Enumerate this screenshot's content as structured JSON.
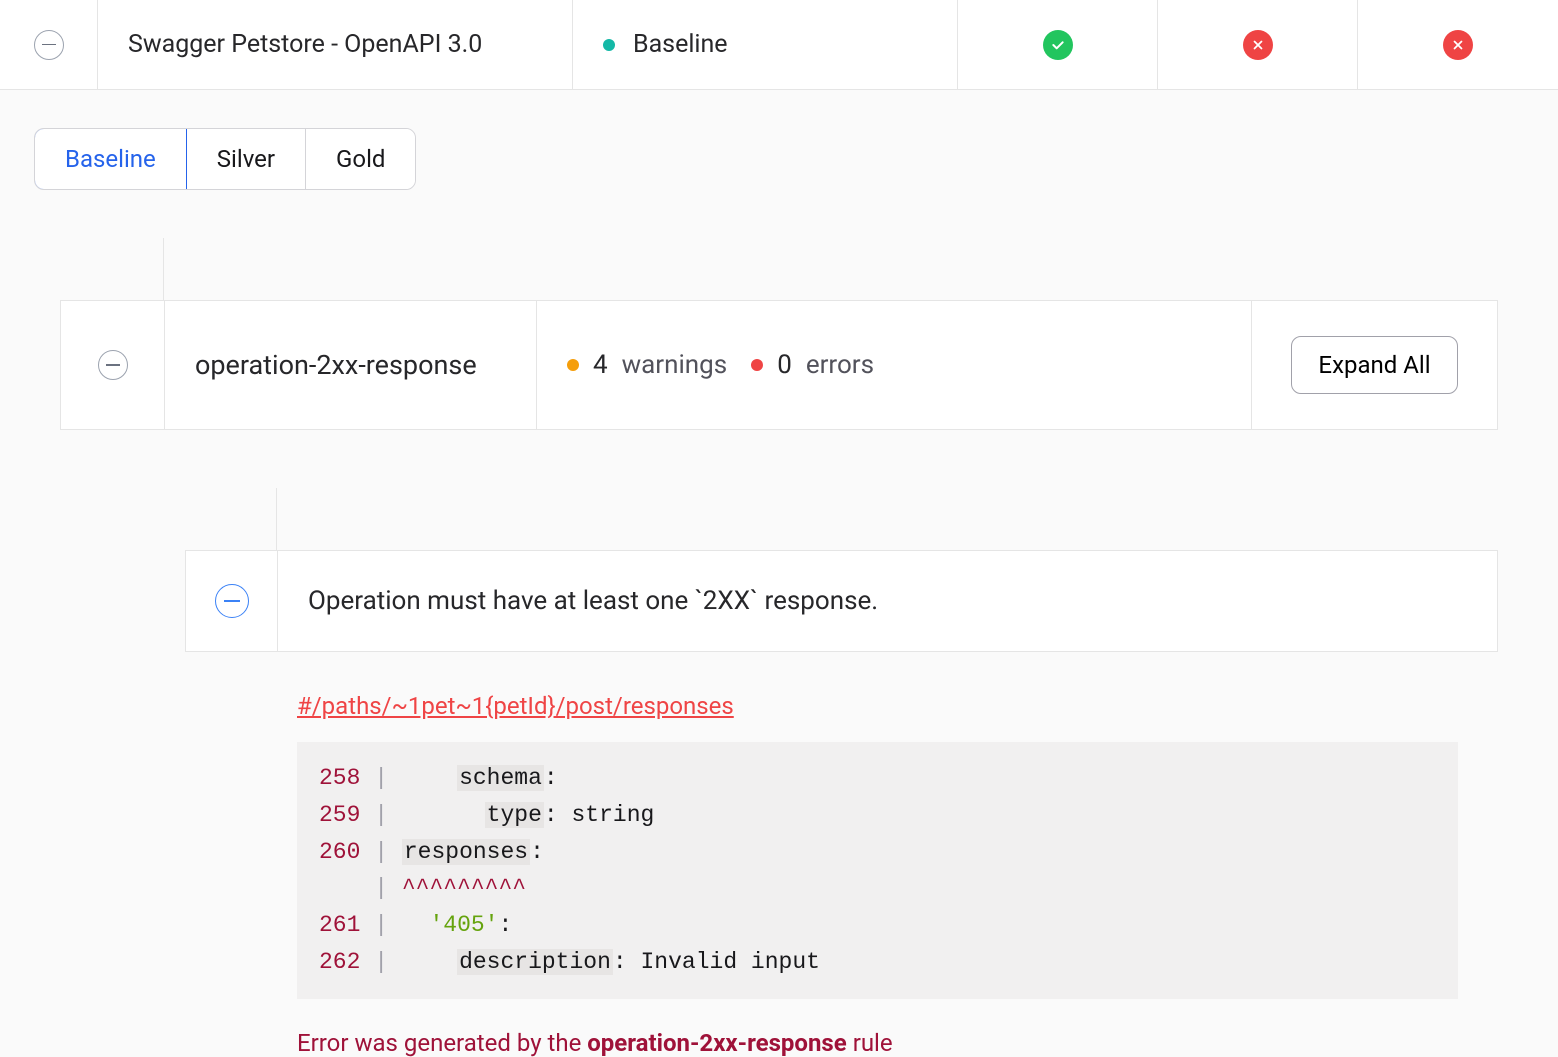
{
  "header": {
    "title": "Swagger Petstore - OpenAPI 3.0",
    "baseline_label": "Baseline"
  },
  "tabs": {
    "baseline": "Baseline",
    "silver": "Silver",
    "gold": "Gold"
  },
  "rule": {
    "name": "operation-2xx-response",
    "warnings_count": "4",
    "warnings_label": "warnings",
    "errors_count": "0",
    "errors_label": "errors",
    "expand_label": "Expand All"
  },
  "detail": {
    "message": "Operation must have at least one `2XX` response.",
    "path": "#/paths/~1pet~1{petId}/post/responses",
    "code": {
      "lines": [
        {
          "num": "258",
          "indent": "    ",
          "key": "schema",
          "colon": ":",
          "value": ""
        },
        {
          "num": "259",
          "indent": "      ",
          "key": "type",
          "colon": ":",
          "value": " string"
        },
        {
          "num": "260",
          "indent": "",
          "key": "responses",
          "colon": ":",
          "value": ""
        },
        {
          "num": "",
          "indent": "",
          "carets": "^^^^^^^^^"
        },
        {
          "num": "261",
          "indent": "  ",
          "key": "'405'",
          "colon": ":",
          "value": "",
          "keyclass": "num-key"
        },
        {
          "num": "262",
          "indent": "    ",
          "key": "description",
          "colon": ":",
          "value": " Invalid input"
        }
      ]
    },
    "error_prefix": "Error was generated by the ",
    "error_rule": "operation-2xx-response",
    "error_suffix": " rule"
  }
}
